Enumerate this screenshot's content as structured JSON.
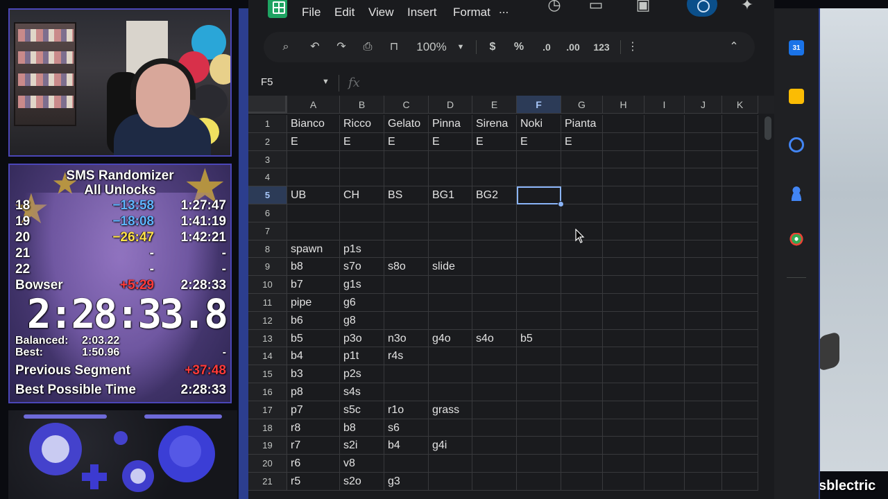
{
  "splits": {
    "title_line1": "SMS Randomizer",
    "title_line2": "All Unlocks",
    "rows": [
      {
        "name": "18",
        "delta": "−13:58",
        "delta_color": "blue",
        "time": "1:27:47"
      },
      {
        "name": "19",
        "delta": "−18:08",
        "delta_color": "blue",
        "time": "1:41:19"
      },
      {
        "name": "20",
        "delta": "−26:47",
        "delta_color": "yellow",
        "time": "1:42:21"
      },
      {
        "name": "21",
        "delta": "-",
        "delta_color": "none",
        "time": "-"
      },
      {
        "name": "22",
        "delta": "-",
        "delta_color": "none",
        "time": "-"
      },
      {
        "name": "Bowser",
        "delta": "+5:29",
        "delta_color": "red",
        "time": "2:28:33"
      }
    ],
    "timer": "2:28:33.8",
    "balanced_label": "Balanced:",
    "balanced_value": "2:03.22",
    "best_label": "Best:",
    "best_value": "1:50.96",
    "best_right": "-",
    "previous_segment_label": "Previous Segment",
    "previous_segment_value": "+37:48",
    "best_possible_label": "Best Possible Time",
    "best_possible_value": "2:28:33"
  },
  "streamer": "sblectric",
  "menu": {
    "file": "File",
    "edit": "Edit",
    "view": "View",
    "insert": "Insert",
    "format": "Format",
    "more": "..."
  },
  "toolbar": {
    "zoom": "100%",
    "currency": "$",
    "percent": "%",
    "decrease_decimal": ".0",
    "increase_decimal": ".00",
    "number_format": "123"
  },
  "formula_bar": {
    "name_box": "F5",
    "fx": "fx"
  },
  "grid": {
    "columns": [
      "A",
      "B",
      "C",
      "D",
      "E",
      "F",
      "G",
      "H",
      "I",
      "J",
      "K"
    ],
    "selected_column": "F",
    "selected_row": "5",
    "rows": [
      {
        "num": "1",
        "cells": [
          "Bianco",
          "Ricco",
          "Gelato",
          "Pinna",
          "Sirena",
          "Noki",
          "Pianta",
          "",
          "",
          "",
          ""
        ]
      },
      {
        "num": "2",
        "cells": [
          "E",
          "E",
          "E",
          "E",
          "E",
          "E",
          "E",
          "",
          "",
          "",
          ""
        ]
      },
      {
        "num": "3",
        "cells": [
          "",
          "",
          "",
          "",
          "",
          "",
          "",
          "",
          "",
          "",
          ""
        ]
      },
      {
        "num": "4",
        "cells": [
          "",
          "",
          "",
          "",
          "",
          "",
          "",
          "",
          "",
          "",
          ""
        ]
      },
      {
        "num": "5",
        "cells": [
          "UB",
          "CH",
          "BS",
          "BG1",
          "BG2",
          "",
          "",
          "",
          "",
          "",
          ""
        ]
      },
      {
        "num": "6",
        "cells": [
          "",
          "",
          "",
          "",
          "",
          "",
          "",
          "",
          "",
          "",
          ""
        ]
      },
      {
        "num": "7",
        "cells": [
          "",
          "",
          "",
          "",
          "",
          "",
          "",
          "",
          "",
          "",
          ""
        ]
      },
      {
        "num": "8",
        "cells": [
          "spawn",
          "p1s",
          "",
          "",
          "",
          "",
          "",
          "",
          "",
          "",
          ""
        ]
      },
      {
        "num": "9",
        "cells": [
          "b8",
          "s7o",
          "s8o",
          "slide",
          "",
          "",
          "",
          "",
          "",
          "",
          ""
        ]
      },
      {
        "num": "10",
        "cells": [
          "b7",
          "g1s",
          "",
          "",
          "",
          "",
          "",
          "",
          "",
          "",
          ""
        ]
      },
      {
        "num": "11",
        "cells": [
          "pipe",
          "g6",
          "",
          "",
          "",
          "",
          "",
          "",
          "",
          "",
          ""
        ]
      },
      {
        "num": "12",
        "cells": [
          "b6",
          "g8",
          "",
          "",
          "",
          "",
          "",
          "",
          "",
          "",
          ""
        ]
      },
      {
        "num": "13",
        "cells": [
          "b5",
          "p3o",
          "n3o",
          "g4o",
          "s4o",
          "b5",
          "",
          "",
          "",
          "",
          ""
        ]
      },
      {
        "num": "14",
        "cells": [
          "b4",
          "p1t",
          "r4s",
          "",
          "",
          "",
          "",
          "",
          "",
          "",
          ""
        ]
      },
      {
        "num": "15",
        "cells": [
          "b3",
          "p2s",
          "",
          "",
          "",
          "",
          "",
          "",
          "",
          "",
          ""
        ]
      },
      {
        "num": "16",
        "cells": [
          "p8",
          "s4s",
          "",
          "",
          "",
          "",
          "",
          "",
          "",
          "",
          ""
        ]
      },
      {
        "num": "17",
        "cells": [
          "p7",
          "s5c",
          "r1o",
          "grass",
          "",
          "",
          "",
          "",
          "",
          "",
          ""
        ]
      },
      {
        "num": "18",
        "cells": [
          "r8",
          "b8",
          "s6",
          "",
          "",
          "",
          "",
          "",
          "",
          "",
          ""
        ]
      },
      {
        "num": "19",
        "cells": [
          "r7",
          "s2i",
          "b4",
          "g4i",
          "",
          "",
          "",
          "",
          "",
          "",
          ""
        ]
      },
      {
        "num": "20",
        "cells": [
          "r6",
          "v8",
          "",
          "",
          "",
          "",
          "",
          "",
          "",
          "",
          ""
        ]
      },
      {
        "num": "21",
        "cells": [
          "r5",
          "s2o",
          "g3",
          "",
          "",
          "",
          "",
          "",
          "",
          "",
          ""
        ]
      }
    ]
  },
  "colors": {
    "accent": "#8ab4f8",
    "sheets_green": "#1ea362",
    "frame_blue": "#2c3e8e",
    "delta_blue": "#5fb4ff",
    "delta_yellow": "#ffe14a",
    "delta_red": "#ff3b3b"
  },
  "side_panel_icons": [
    "calendar-icon",
    "keep-icon",
    "tasks-icon",
    "contacts-icon",
    "maps-icon"
  ],
  "calendar_day": "31"
}
